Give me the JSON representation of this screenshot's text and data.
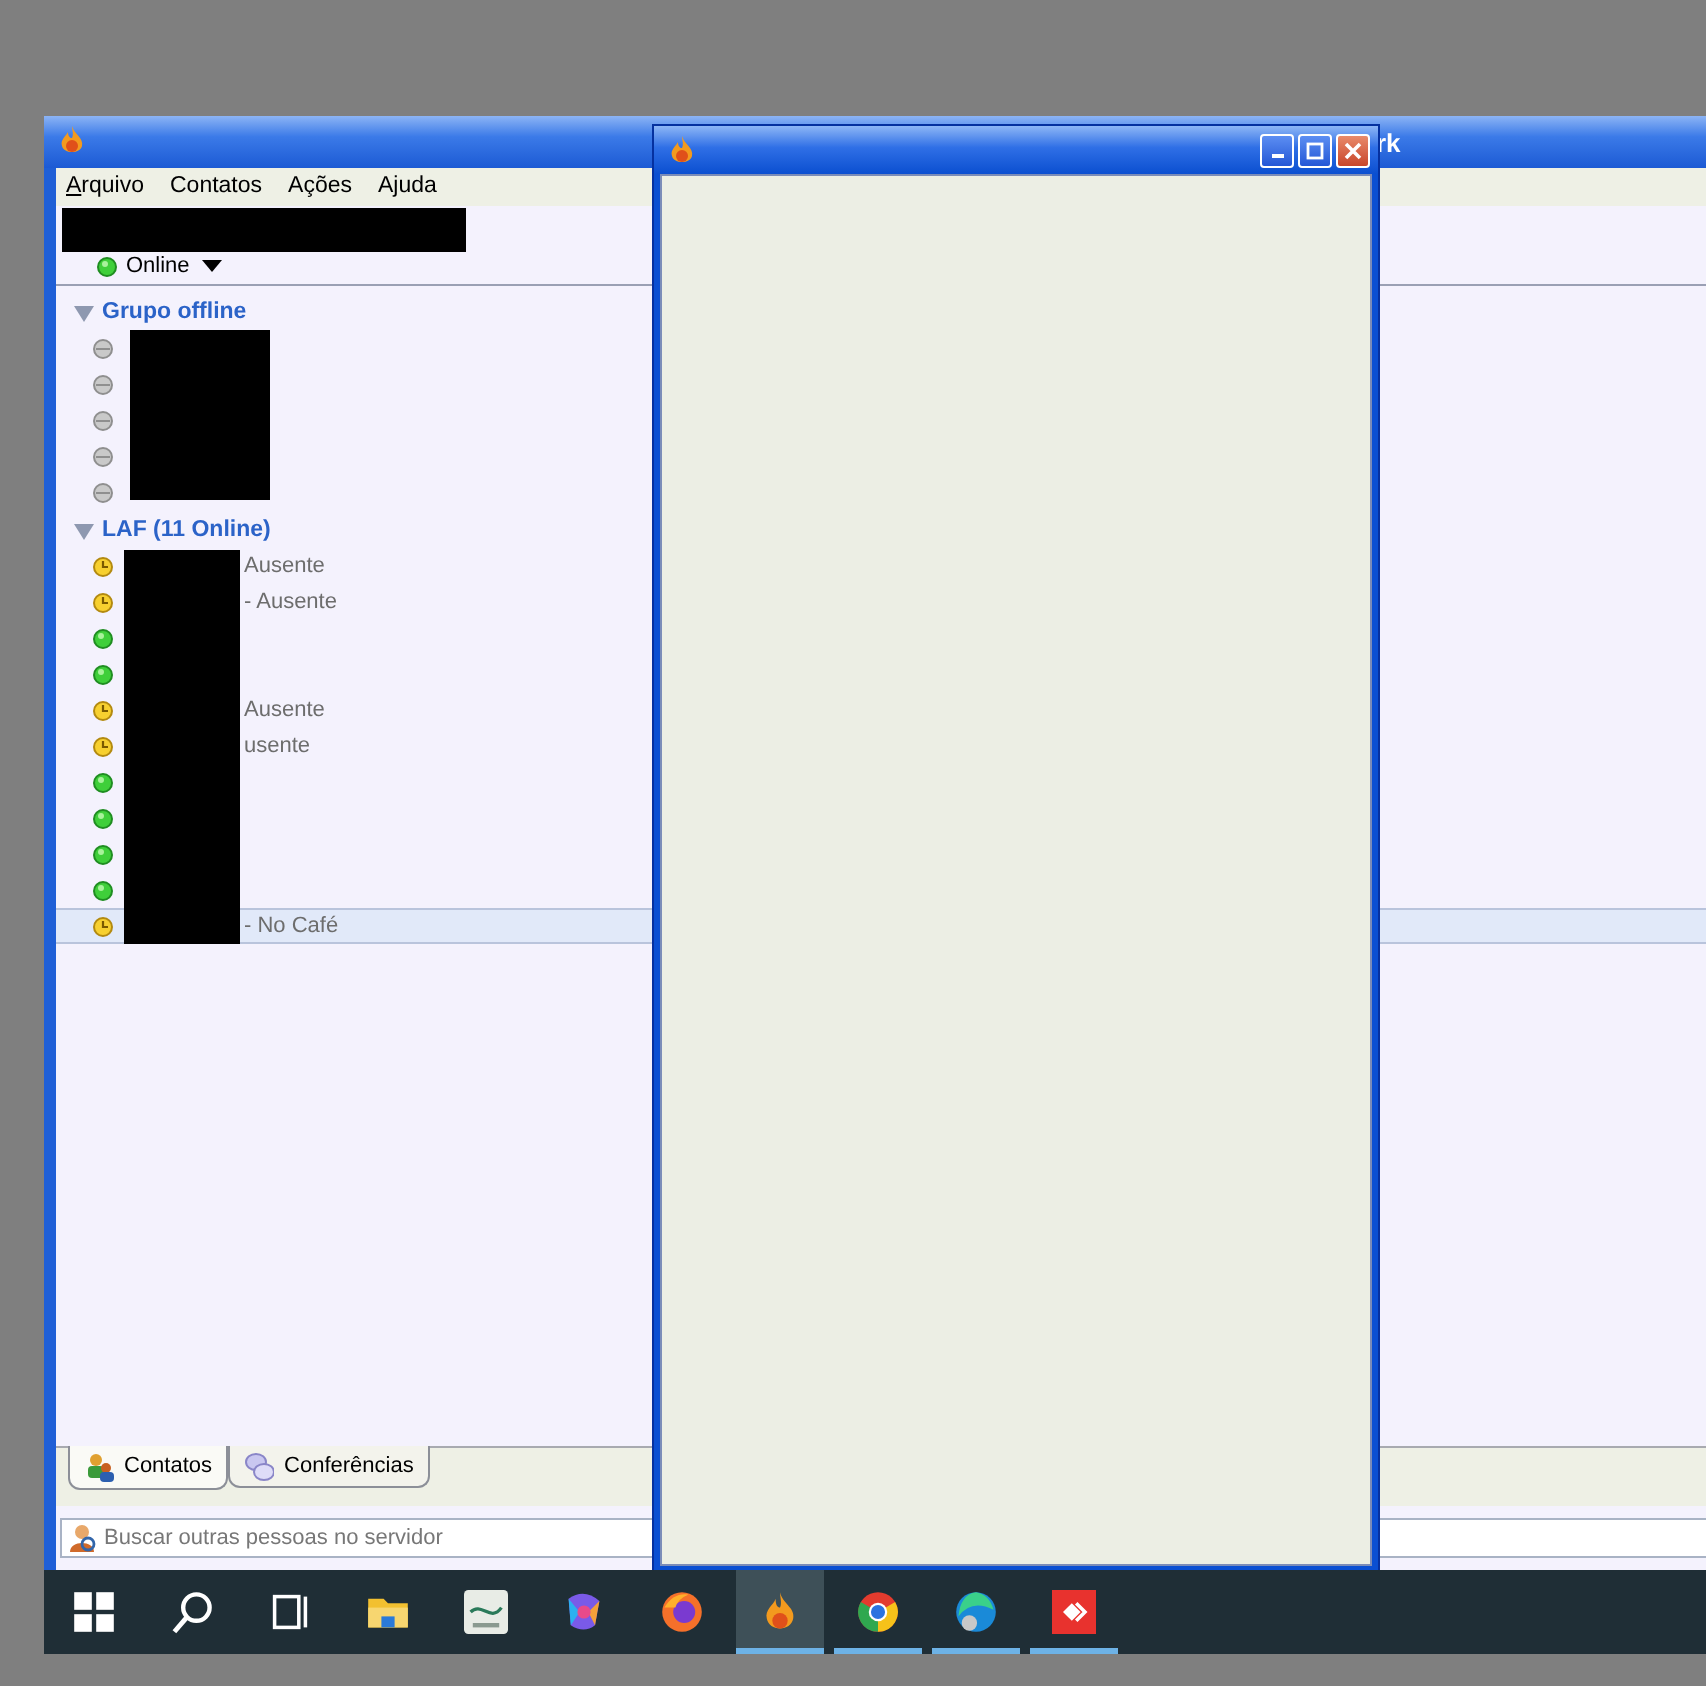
{
  "main_window": {
    "title": "rk",
    "menu": [
      {
        "label": "Arquivo",
        "mnemonic": true
      },
      {
        "label": "Contatos",
        "mnemonic": false
      },
      {
        "label": "Ações",
        "mnemonic": false
      },
      {
        "label": "Ajuda",
        "mnemonic": false
      }
    ],
    "profile": {
      "kind": "online",
      "status": "Online"
    },
    "groups": [
      {
        "name": "Grupo offline",
        "expanded": true,
        "contacts": [
          {
            "kind": "offline",
            "selected": false
          },
          {
            "kind": "offline",
            "selected": false
          },
          {
            "kind": "offline",
            "selected": false
          },
          {
            "kind": "offline",
            "selected": false
          },
          {
            "kind": "offline",
            "selected": false
          }
        ]
      },
      {
        "name": "LAF (11 Online)",
        "expanded": true,
        "contacts": [
          {
            "kind": "away",
            "status_text": "Ausente",
            "selected": false
          },
          {
            "kind": "away",
            "status_text": "- Ausente",
            "selected": false
          },
          {
            "kind": "online",
            "selected": false
          },
          {
            "kind": "online",
            "selected": false
          },
          {
            "kind": "away",
            "status_text": "Ausente",
            "selected": false
          },
          {
            "kind": "away",
            "status_text": "usente",
            "selected": false
          },
          {
            "kind": "online",
            "selected": false
          },
          {
            "kind": "online",
            "selected": false
          },
          {
            "kind": "online",
            "selected": false
          },
          {
            "kind": "online",
            "selected": false
          },
          {
            "kind": "away",
            "status_text": "- No Café",
            "selected": true
          }
        ]
      }
    ],
    "tabs": [
      {
        "label": "Contatos",
        "kind": "contacts",
        "selected": true
      },
      {
        "label": "Conferências",
        "kind": "conferences",
        "selected": false
      }
    ],
    "search": {
      "placeholder": "Buscar outras pessoas no servidor"
    }
  },
  "popup_window": {
    "controls": [
      {
        "kind": "minimize"
      },
      {
        "kind": "maximize"
      },
      {
        "kind": "close"
      }
    ]
  },
  "taskbar": [
    {
      "kind": "start",
      "active": false,
      "running": false
    },
    {
      "kind": "search",
      "active": false,
      "running": false
    },
    {
      "kind": "task-view",
      "active": false,
      "running": false
    },
    {
      "kind": "folder",
      "active": false,
      "running": false
    },
    {
      "kind": "tile",
      "active": false,
      "running": false
    },
    {
      "kind": "swirl",
      "active": false,
      "running": false
    },
    {
      "kind": "fox",
      "active": false,
      "running": false
    },
    {
      "kind": "flame",
      "active": true,
      "running": true
    },
    {
      "kind": "ring",
      "active": false,
      "running": true
    },
    {
      "kind": "wave",
      "active": false,
      "running": true
    },
    {
      "kind": "diamond",
      "active": false,
      "running": true
    }
  ]
}
